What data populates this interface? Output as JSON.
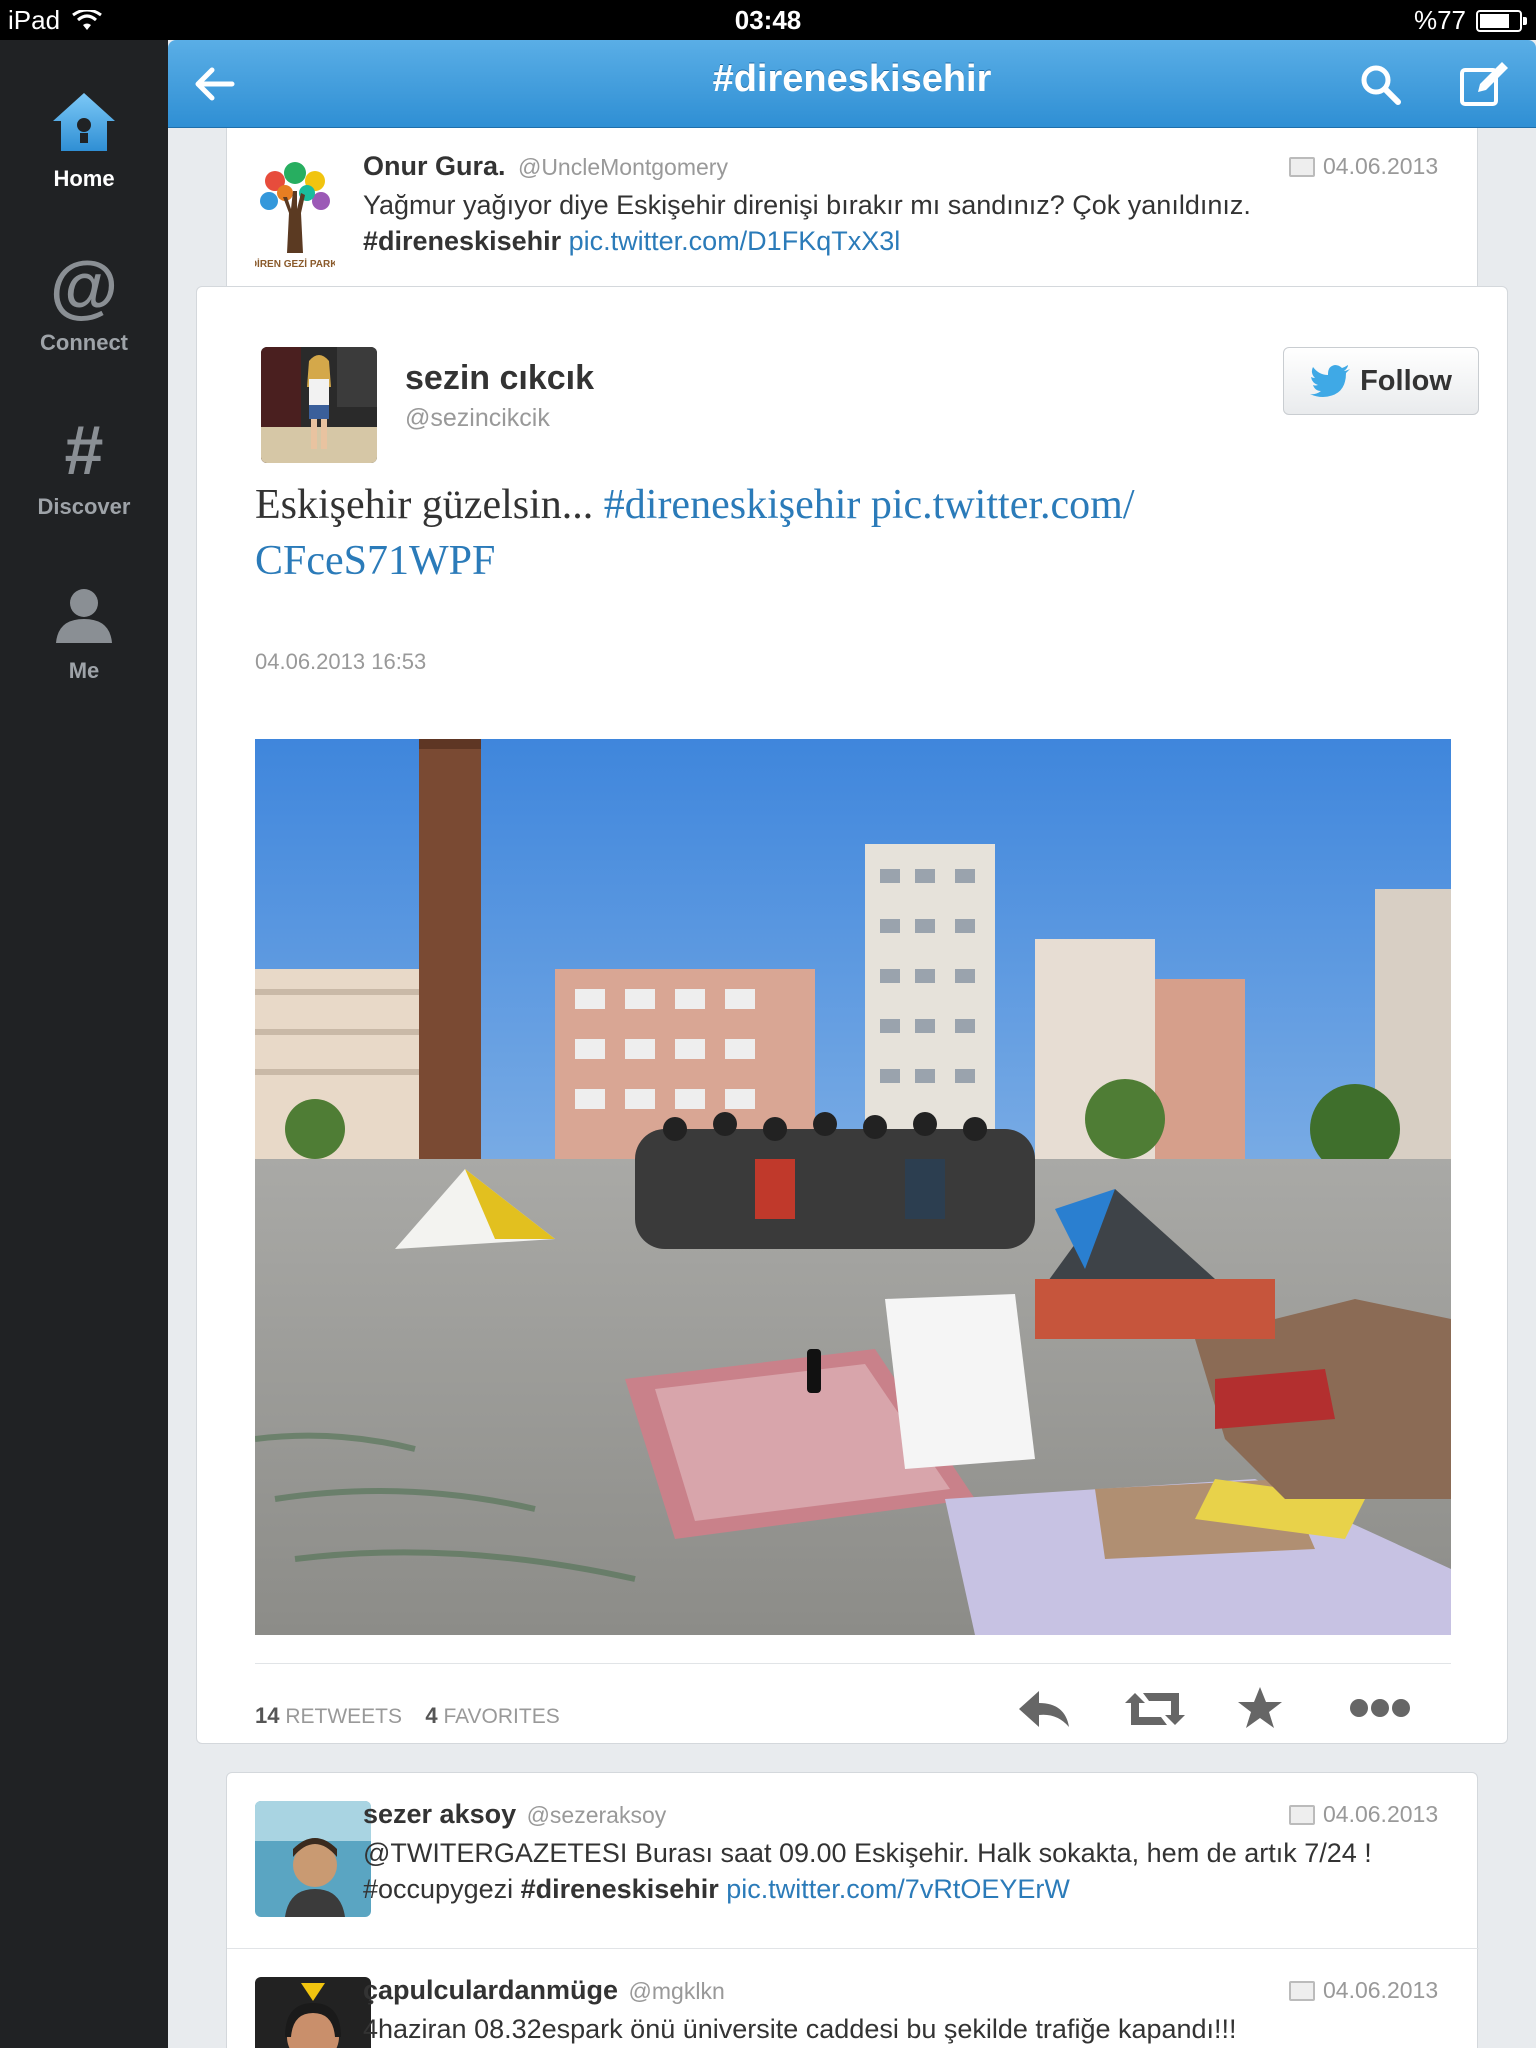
{
  "status_bar": {
    "device": "iPad",
    "time": "03:48",
    "battery": "%77",
    "battery_level": 0.77
  },
  "sidebar": {
    "items": [
      {
        "label": "Home",
        "icon": "home-icon",
        "active": true
      },
      {
        "label": "Connect",
        "icon": "at-icon",
        "active": false
      },
      {
        "label": "Discover",
        "icon": "hash-icon",
        "active": false
      },
      {
        "label": "Me",
        "icon": "person-icon",
        "active": false
      }
    ]
  },
  "header": {
    "title": "#direneskisehir",
    "back_icon": "back-arrow-icon",
    "search_icon": "search-icon",
    "compose_icon": "compose-icon"
  },
  "tweets": {
    "prev": {
      "name": "Onur Gura.",
      "handle": "@UncleMontgomery",
      "date": "04.06.2013",
      "text": "Yağmur yağıyor diye Eskişehir direnişi bırakır mı sandınız? Çok yanıldınız.",
      "hashtag": "#direneskisehir",
      "link": "pic.twitter.com/D1FKqTxX3l",
      "avatar_caption": "DİREN GEZİ PARKI"
    },
    "main": {
      "name": "sezin cıkcık",
      "handle": "@sezincikcik",
      "follow_label": "Follow",
      "text_plain": "Eskişehir güzelsin...",
      "text_hashtag": "#direneskişehir",
      "text_link": "pic.twitter.com/CFceS71WPF",
      "text_link_line1": "pic.twitter.com/",
      "text_link_line2": "CFceS71WPF",
      "timestamp": "04.06.2013 16:53",
      "retweets_count": "14",
      "retweets_label": "RETWEETS",
      "favorites_count": "4",
      "favorites_label": "FAVORITES"
    },
    "next1": {
      "name": "sezer aksoy",
      "handle": "@sezeraksoy",
      "date": "04.06.2013",
      "text": "@TWITERGAZETESI Burası saat 09.00 Eskişehir. Halk sokakta, hem de artık 7/24 !",
      "text2_plain": "#occupygezi",
      "hashtag": "#direneskisehir",
      "link": "pic.twitter.com/7vRtOEYErW"
    },
    "next2": {
      "name": "çapulculardanmüge",
      "handle": "@mgklkn",
      "date": "04.06.2013",
      "text": "4haziran 08.32espark önü üniversite caddesi bu şekilde trafiğe kapandı!!!"
    }
  },
  "colors": {
    "accent": "#2f8fd4",
    "link": "#2b7bb9",
    "sidebar": "#202224"
  }
}
